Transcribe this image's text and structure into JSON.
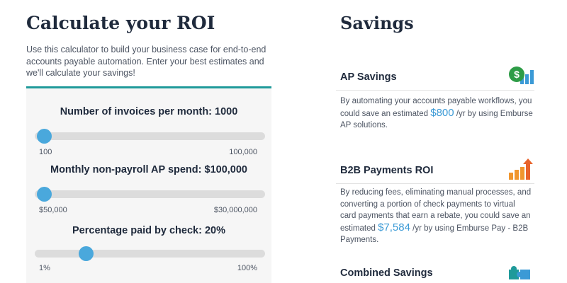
{
  "calculator": {
    "title": "Calculate your ROI",
    "intro": "Use this calculator to build your business case for end-to-end accounts payable automation. Enter your best estimates and we'll calculate your savings!",
    "sliders": [
      {
        "label": "Number of invoices per month: 1000",
        "min_label": "100",
        "max_label": "100,000",
        "position_percent": 4
      },
      {
        "label": "Monthly non-payroll AP spend: $100,000",
        "min_label": "$50,000",
        "max_label": "$30,000,000",
        "position_percent": 4
      },
      {
        "label": "Percentage paid by check: 20%",
        "min_label": "1%",
        "max_label": "100%",
        "position_percent": 22
      }
    ],
    "accent_color": "#1f9a9a",
    "thumb_color": "#4aa8dc"
  },
  "savings": {
    "title": "Savings",
    "ap_savings": {
      "title": "AP Savings",
      "text_before": "By automating your accounts payable workflows, you could save an estimated",
      "amount": "$800",
      "text_after": "/yr by using Emburse AP solutions.",
      "icon": "dollar-chart-icon"
    },
    "b2b_payments": {
      "title": "B2B Payments ROI",
      "text_before": "By reducing fees, eliminating manual processes, and converting a portion of check payments to virtual card payments that earn a rebate, you could save an estimated",
      "amount": "$7,584",
      "text_after": "/yr by using Emburse Pay - B2B Payments.",
      "icon": "growth-chart-icon"
    },
    "combined": {
      "title": "Combined Savings",
      "icon": "puzzle-icon"
    },
    "amount_color": "#3b9ad6"
  }
}
